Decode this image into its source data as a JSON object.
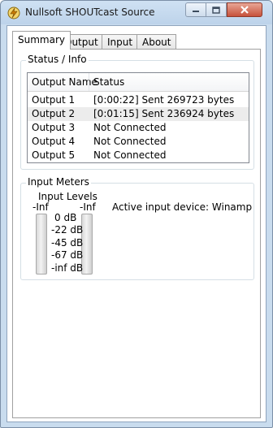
{
  "window": {
    "title": "Nullsoft SHOUTcast Source",
    "icon": "winamp-lightning-icon",
    "buttons": [
      "minimize-icon",
      "maximize-icon",
      "close-icon"
    ]
  },
  "tabs": [
    {
      "label": "Summary",
      "active": true
    },
    {
      "label": "Output",
      "active": false
    },
    {
      "label": "Input",
      "active": false
    },
    {
      "label": "About",
      "active": false
    }
  ],
  "status_group": {
    "label": "Status / Info",
    "columns": [
      "Output Name",
      "Status"
    ],
    "rows": [
      {
        "name": "Output 1",
        "status": "[0:00:22] Sent 269723 bytes"
      },
      {
        "name": "Output 2",
        "status": "[0:01:15] Sent 236924 bytes"
      },
      {
        "name": "Output 3",
        "status": "Not Connected"
      },
      {
        "name": "Output 4",
        "status": "Not Connected"
      },
      {
        "name": "Output 5",
        "status": "Not Connected"
      }
    ]
  },
  "input_meters": {
    "label": "Input Meters",
    "levels_label": "Input Levels",
    "left_value": "-Inf",
    "right_value": "-Inf",
    "scale": [
      "0 dB",
      "-22 dB",
      "-45 dB",
      "-67 dB",
      "-inf dB"
    ],
    "device_text": "Active input device: Winamp"
  },
  "colors": {
    "frame": "#c9dcee",
    "close_button": "#c7523b",
    "selected_row": "#ececec"
  }
}
